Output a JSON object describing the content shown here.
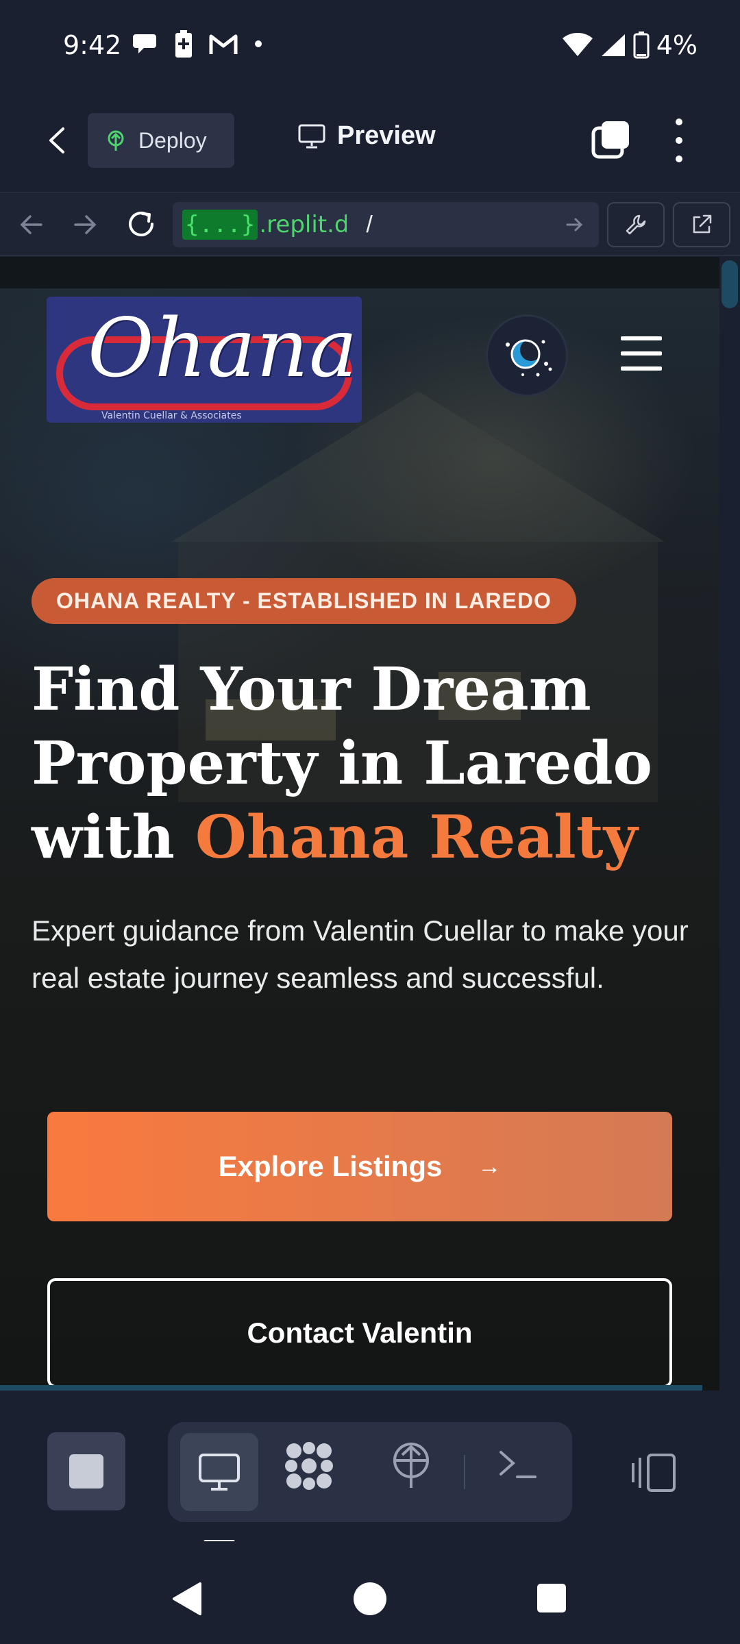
{
  "status_bar": {
    "time": "9:42",
    "battery": "4%"
  },
  "app_header": {
    "deploy_label": "Deploy",
    "preview_label": "Preview"
  },
  "url_bar": {
    "host_badge": "{...}",
    "host": ".replit.de",
    "path": "/"
  },
  "site": {
    "logo_text": "Ohana",
    "logo_sub": "Valentin Cuellar & Associates",
    "tagline": "OHANA REALTY - ESTABLISHED IN LAREDO",
    "headline_line1": "Find Your Dream",
    "headline_line2": "Property in Laredo",
    "headline_with": "with ",
    "headline_accent": "Ohana Realty",
    "subtext": "Expert guidance from Valentin Cuellar to make your real estate journey seamless and successful.",
    "explore_label": "Explore Listings",
    "explore_arrow": "→",
    "contact_label": "Contact Valentin",
    "accent_color": "#f47a3d",
    "tagline_color": "#c85a35"
  }
}
